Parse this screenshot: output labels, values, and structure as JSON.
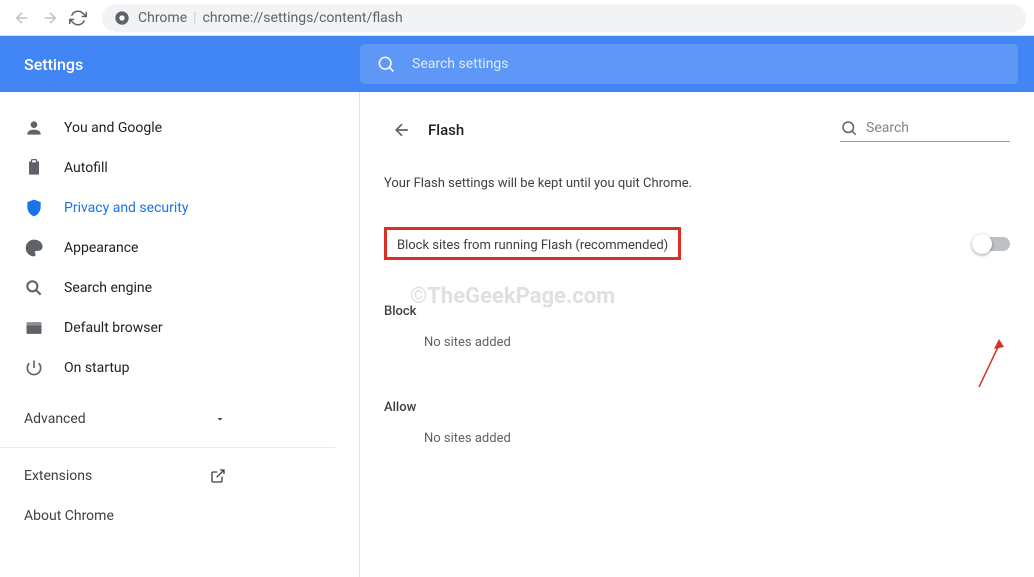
{
  "browser": {
    "url_host": "Chrome",
    "url_path": "chrome://settings/content/flash"
  },
  "header": {
    "title": "Settings",
    "search_placeholder": "Search settings"
  },
  "sidebar": {
    "items": [
      {
        "label": "You and Google"
      },
      {
        "label": "Autofill"
      },
      {
        "label": "Privacy and security"
      },
      {
        "label": "Appearance"
      },
      {
        "label": "Search engine"
      },
      {
        "label": "Default browser"
      },
      {
        "label": "On startup"
      }
    ],
    "advanced": "Advanced",
    "extensions": "Extensions",
    "about": "About Chrome"
  },
  "content": {
    "title": "Flash",
    "search_placeholder": "Search",
    "info_text": "Your Flash settings will be kept until you quit Chrome.",
    "main_setting": "Block sites from running Flash (recommended)",
    "block_label": "Block",
    "block_empty": "No sites added",
    "allow_label": "Allow",
    "allow_empty": "No sites added"
  },
  "watermark": "©TheGeekPage.com"
}
